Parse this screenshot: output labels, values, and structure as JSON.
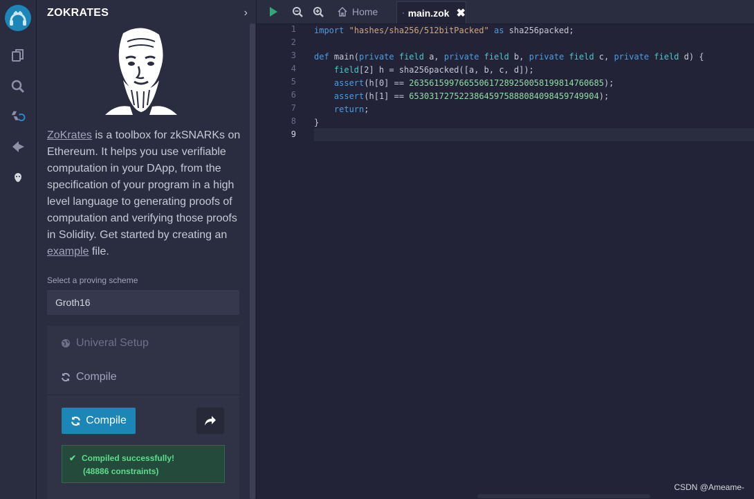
{
  "app": {
    "title": "ZOKRATES"
  },
  "colors": {
    "accent": "#1c87b6",
    "success": "#5fdd8c",
    "background": "#222336",
    "panel": "#2a2c3f"
  },
  "rail": {
    "items": [
      {
        "name": "remix-logo-icon"
      },
      {
        "name": "file-explorer-icon"
      },
      {
        "name": "search-icon"
      },
      {
        "name": "solidity-compiler-icon"
      },
      {
        "name": "deploy-run-icon"
      },
      {
        "name": "zokrates-plugin-icon"
      }
    ]
  },
  "panel": {
    "title": "ZOKRATES",
    "intro": {
      "link1": "ZoKrates",
      "text1": " is a toolbox for zkSNARKs on Ethereum. It helps you use verifiable computation in your DApp, from the specification of your program in a high level language to generating proofs of computation and verifying those proofs in Solidity. Get started by creating an ",
      "link2": "example",
      "text2": " file."
    },
    "scheme_label": "Select a proving scheme",
    "scheme_value": "Groth16",
    "setup_label": "Univeral Setup",
    "compile_section_label": "Compile",
    "compile_button": "Compile",
    "success_line1": "Compiled successfully!",
    "success_line2": "(48886 constraints)"
  },
  "tabs": {
    "home_label": "Home",
    "active_label": "main.zok"
  },
  "editor": {
    "line_numbers": [
      "1",
      "2",
      "3",
      "4",
      "5",
      "6",
      "7",
      "8",
      "9"
    ],
    "active_line": 9,
    "code": {
      "l1_import": "import",
      "l1_str": "\"hashes/sha256/512bitPacked\"",
      "l1_as": "as",
      "l1_rest": " sha256packed;",
      "l3_def": "def",
      "l3_main": " main(",
      "l3_private": "private",
      "l3_field": "field",
      "l3_a": " a, ",
      "l3_b": " b, ",
      "l3_c": " c, ",
      "l3_d": " d) {",
      "l4_indent": "    ",
      "l4_field": "field",
      "l4_rest": "[2] h = sha256packed([a, b, c, d]);",
      "l5_assert": "assert",
      "l5_mid": "(h[0] == ",
      "l5_num": "263561599766550617289250058199814760685",
      "l5_end": ");",
      "l6_assert": "assert",
      "l6_mid": "(h[1] == ",
      "l6_num": "65303172752238645975888084098459749904",
      "l6_end": ");",
      "l7_return": "return",
      "l7_end": ";",
      "l8": "}"
    }
  },
  "watermark": "CSDN @Ameame-"
}
